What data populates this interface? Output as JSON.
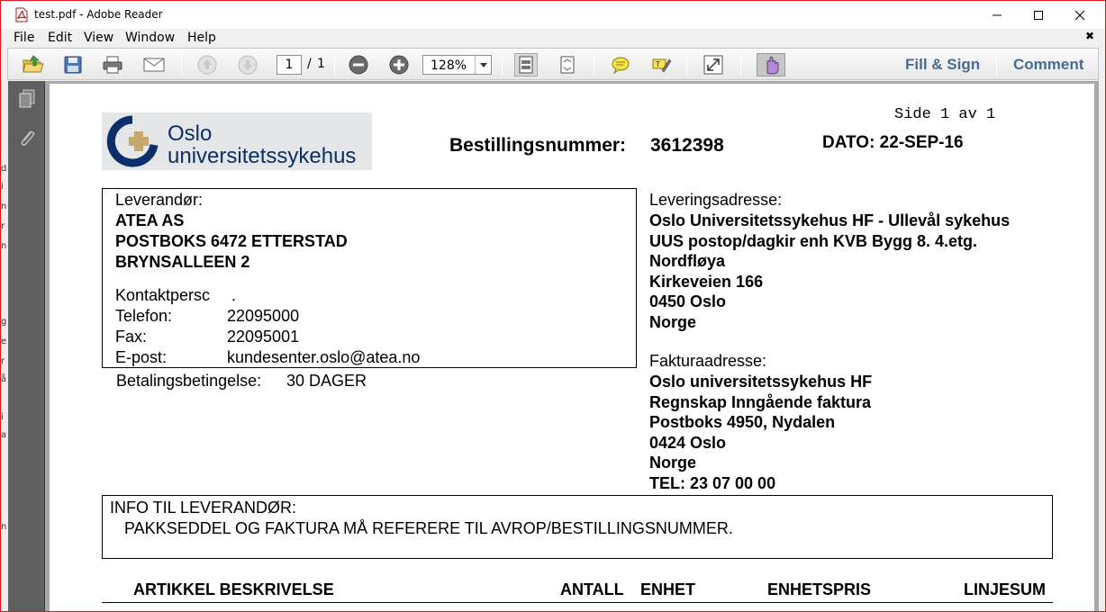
{
  "window": {
    "title": "test.pdf - Adobe Reader"
  },
  "menu": [
    "File",
    "Edit",
    "View",
    "Window",
    "Help"
  ],
  "toolbar": {
    "page_current": "1",
    "page_separator": "/",
    "page_total": "1",
    "zoom": "128%",
    "fill_sign": "Fill & Sign",
    "comment": "Comment"
  },
  "colors": {
    "accent_link": "#4a6b91",
    "window_border": "#e81123",
    "nav_pane": "#5f5f5f",
    "doc_background": "#a8a8a8"
  },
  "icons": [
    "open-icon",
    "save-icon",
    "print-icon",
    "email-icon",
    "prev-page-icon",
    "next-page-icon",
    "zoom-out-icon",
    "zoom-in-icon",
    "fit-page-icon",
    "fit-width-icon",
    "sticky-note-icon",
    "highlight-icon",
    "fullscreen-icon",
    "touch-mode-icon",
    "pages-icon",
    "attachment-icon"
  ],
  "document": {
    "page_indicator": "Side 1 av 1",
    "logo_line1": "Oslo",
    "logo_line2": "universitetssykehus",
    "order_label": "Bestillingsnummer:",
    "order_number": "3612398",
    "date": "DATO: 22-SEP-16",
    "supplier": {
      "heading": "Leverandør:",
      "name": "ATEA AS",
      "address1": "POSTBOKS 6472 ETTERSTAD",
      "address2": "BRYNSALLEEN 2",
      "contact_label": "Kontaktpersc",
      "contact_value": ".",
      "phone_label": "Telefon:",
      "phone_value": "22095000",
      "fax_label": "Fax:",
      "fax_value": "22095001",
      "email_label": "E-post:",
      "email_value": "kundesenter.oslo@atea.no"
    },
    "payment_terms_label": "Betalingsbetingelse:",
    "payment_terms_value": "30 DAGER",
    "delivery": {
      "heading": "Leveringsadresse:",
      "lines": [
        "Oslo Universitetssykehus HF - Ullevål sykehus",
        "UUS postop/dagkir enh KVB Bygg 8. 4.etg.",
        "Nordfløya",
        "Kirkeveien 166",
        "0450 Oslo",
        "Norge"
      ]
    },
    "invoice": {
      "heading": "Fakturaadresse:",
      "lines": [
        "Oslo universitetssykehus HF",
        "Regnskap Inngående faktura",
        "Postboks 4950, Nydalen",
        "0424 Oslo",
        "Norge",
        "TEL: 23 07 00 00"
      ]
    },
    "info_heading": "INFO TIL LEVERANDØR:",
    "info_text": "PAKKSEDDEL OG FAKTURA MÅ REFERERE TIL AVROP/BESTILLINGSNUMMER.",
    "table_headers": [
      "ARTIKKEL BESKRIVELSE",
      "ANTALL",
      "ENHET",
      "ENHETSPRIS",
      "LINJESUM"
    ]
  }
}
